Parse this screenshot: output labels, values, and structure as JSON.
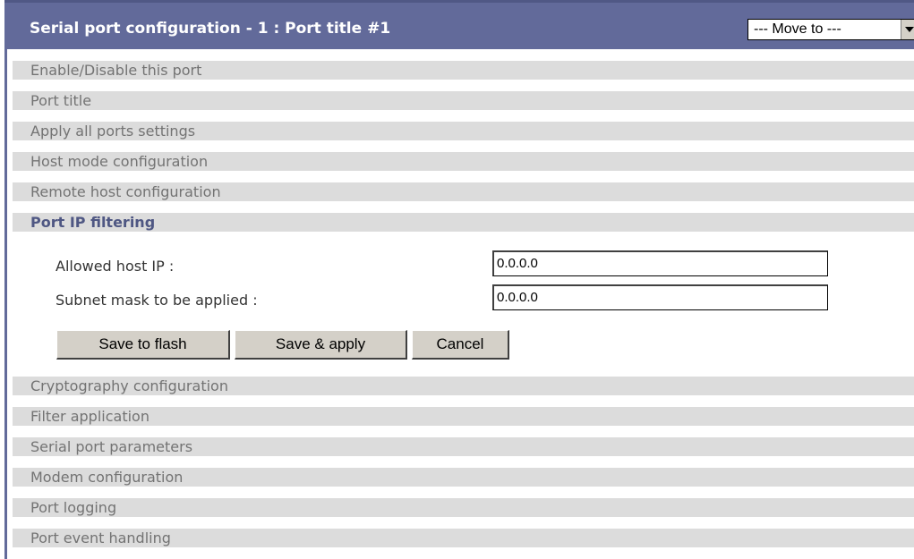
{
  "header": {
    "title": "Serial port configuration - 1 : Port title #1",
    "move_to": "--- Move to ---"
  },
  "sections_top": [
    {
      "label": "Enable/Disable this port"
    },
    {
      "label": "Port title"
    },
    {
      "label": "Apply all ports settings"
    },
    {
      "label": "Host mode configuration"
    },
    {
      "label": "Remote host configuration"
    }
  ],
  "active_section": {
    "label": "Port IP filtering"
  },
  "form": {
    "allowed_host_label": "Allowed host IP :",
    "allowed_host_value": "0.0.0.0",
    "subnet_label": "Subnet mask to be applied :",
    "subnet_value": "0.0.0.0",
    "buttons": {
      "save_flash": "Save to flash",
      "save_apply": "Save & apply",
      "cancel": "Cancel"
    }
  },
  "sections_bottom": [
    {
      "label": "Cryptography configuration"
    },
    {
      "label": "Filter application"
    },
    {
      "label": "Serial port parameters"
    },
    {
      "label": "Modem configuration"
    },
    {
      "label": "Port logging"
    },
    {
      "label": "Port event handling"
    }
  ],
  "colors": {
    "header_bg": "#626a9a",
    "section_bg": "#dcdcdc",
    "active_text": "#4f5783"
  }
}
